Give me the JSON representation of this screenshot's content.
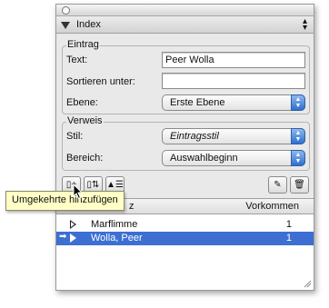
{
  "window": {
    "tab_title": "Index",
    "tab_menu_arrows": "▲\n▼"
  },
  "entry": {
    "group_label": "Eintrag",
    "text_label": "Text:",
    "text_value": "Peer Wolla",
    "sort_label": "Sortieren unter:",
    "sort_value": "",
    "level_label": "Ebene:",
    "level_value": "Erste Ebene"
  },
  "reference": {
    "group_label": "Verweis",
    "style_label": "Stil:",
    "style_value": "Eintragsstil",
    "range_label": "Bereich:",
    "range_value": "Auswahlbeginn"
  },
  "tooltip": {
    "text": "Umgekehrte hinzufügen"
  },
  "list": {
    "header_left_fragment": "z",
    "header_right": "Vorkommen",
    "rows": [
      {
        "name": "Marflimme",
        "count": "1",
        "selected": false
      },
      {
        "name": "Wolla, Peer",
        "count": "1",
        "selected": true
      }
    ]
  },
  "icons": [
    "circle-button-icon",
    "disclosure-triangle-icon",
    "popup-arrows-icon",
    "add-entry-icon",
    "add-reversed-icon",
    "sort-icon",
    "pencil-icon",
    "trash-icon",
    "pointer-cursor-icon"
  ],
  "colors": {
    "selection": "#3d6fd2",
    "tooltip_bg": "#ffffc6",
    "stepper_blue": "#2f6fd0"
  }
}
